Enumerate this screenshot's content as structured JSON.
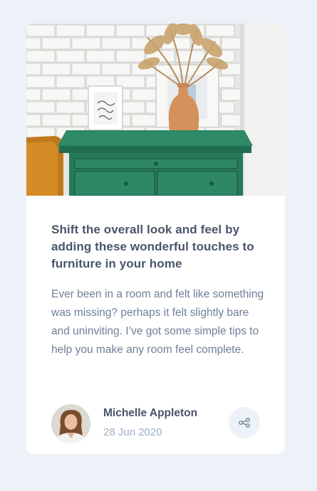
{
  "article": {
    "image_alt": "Green drawers with vase and framed picture",
    "title": "Shift the overall look and feel by adding these wonderful touches to furniture in your home",
    "description": "Ever been in a room and felt like something was missing? perhaps it felt slightly bare and uninviting. I’ve got some simple tips to help you make any room feel complete."
  },
  "author": {
    "name": "Michelle Appleton",
    "date": "28 Jun 2020"
  },
  "share": {
    "icon": "share-icon",
    "aria_label": "Share"
  },
  "colors": {
    "background": "#ecf2f8",
    "card": "#ffffff",
    "title": "#48556a",
    "body": "#6e8098",
    "muted": "#9eafc2"
  }
}
